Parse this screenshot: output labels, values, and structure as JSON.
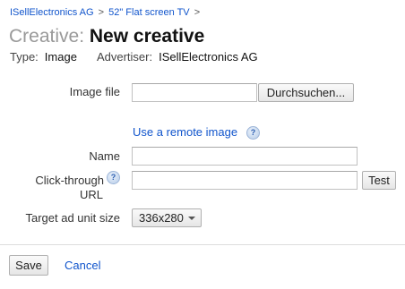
{
  "breadcrumb": {
    "items": [
      "ISellElectronics AG",
      "52\" Flat screen TV"
    ],
    "separator": ">"
  },
  "title": {
    "prefix": "Creative:",
    "name": "New creative"
  },
  "meta": {
    "type_label": "Type:",
    "type_value": "Image",
    "advertiser_label": "Advertiser:",
    "advertiser_value": "ISellElectronics AG"
  },
  "form": {
    "image_file": {
      "label": "Image file",
      "value": "",
      "browse_label": "Durchsuchen..."
    },
    "remote_image": {
      "link_label": "Use a remote image",
      "help_icon": "help-icon"
    },
    "name": {
      "label": "Name",
      "value": ""
    },
    "click_through": {
      "label_line1": "Click-through",
      "label_line2": "URL",
      "help_icon": "help-icon",
      "value": "",
      "test_label": "Test"
    },
    "target_size": {
      "label": "Target ad unit size",
      "selected": "336x280"
    }
  },
  "footer": {
    "save_label": "Save",
    "cancel_label": "Cancel"
  },
  "colors": {
    "link": "#1155cc",
    "title_prefix": "#999999",
    "divider": "#dddddd"
  }
}
